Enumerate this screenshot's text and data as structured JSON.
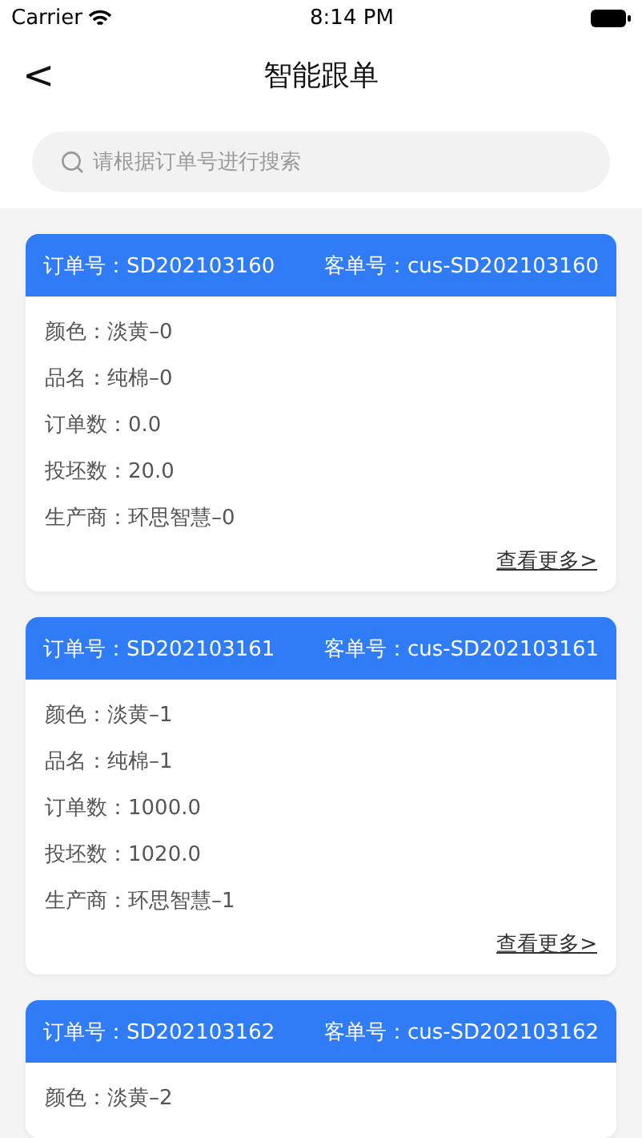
{
  "status_bar": {
    "carrier": "Carrier",
    "time": "8:14 PM"
  },
  "nav": {
    "back": "<",
    "title": "智能跟单"
  },
  "search": {
    "placeholder": "请根据订单号进行搜索"
  },
  "orders": [
    {
      "order_no": "订单号：SD202103160",
      "customer_no": "客单号：cus-SD202103160",
      "fields": [
        "颜色：淡黄–0",
        "品名：纯棉–0",
        "订单数：0.0",
        "投坯数：20.0",
        "生产商：环思智慧–0"
      ],
      "more": "查看更多>"
    },
    {
      "order_no": "订单号：SD202103161",
      "customer_no": "客单号：cus-SD202103161",
      "fields": [
        "颜色：淡黄–1",
        "品名：纯棉–1",
        "订单数：1000.0",
        "投坯数：1020.0",
        "生产商：环思智慧–1"
      ],
      "more": "查看更多>"
    },
    {
      "order_no": "订单号：SD202103162",
      "customer_no": "客单号：cus-SD202103162",
      "fields": [
        "颜色：淡黄–2"
      ]
    }
  ]
}
